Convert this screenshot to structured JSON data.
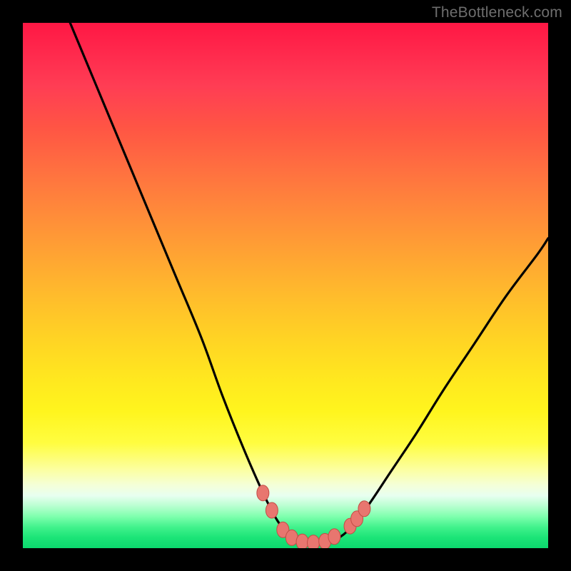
{
  "watermark": "TheBottleneck.com",
  "colors": {
    "frame": "#000000",
    "curve_stroke": "#000000",
    "marker_fill": "#e8766f",
    "marker_stroke": "#c24c45"
  },
  "chart_data": {
    "type": "line",
    "title": "",
    "xlabel": "",
    "ylabel": "",
    "xlim": [
      0,
      100
    ],
    "ylim": [
      0,
      100
    ],
    "grid": false,
    "legend": false,
    "series": [
      {
        "name": "bottleneck-curve",
        "x": [
          9,
          14,
          19,
          24,
          29,
          34,
          38,
          42,
          45.5,
          48,
          50,
          52,
          54,
          56,
          58,
          60.5,
          63,
          66,
          70,
          75,
          80,
          86,
          92,
          98,
          100
        ],
        "y": [
          100,
          88,
          76,
          64,
          52,
          40,
          29,
          19,
          11,
          6,
          3.2,
          1.8,
          1.1,
          1.0,
          1.2,
          2.2,
          4.5,
          8.5,
          14.5,
          22,
          30,
          39,
          48,
          56,
          59
        ]
      }
    ],
    "markers": [
      {
        "x": 45.7,
        "y": 10.5
      },
      {
        "x": 47.4,
        "y": 7.2
      },
      {
        "x": 49.5,
        "y": 3.5
      },
      {
        "x": 51.2,
        "y": 2.0
      },
      {
        "x": 53.2,
        "y": 1.2
      },
      {
        "x": 55.3,
        "y": 1.0
      },
      {
        "x": 57.5,
        "y": 1.3
      },
      {
        "x": 59.3,
        "y": 2.2
      },
      {
        "x": 62.3,
        "y": 4.2
      },
      {
        "x": 63.6,
        "y": 5.6
      },
      {
        "x": 65.0,
        "y": 7.5
      }
    ]
  }
}
